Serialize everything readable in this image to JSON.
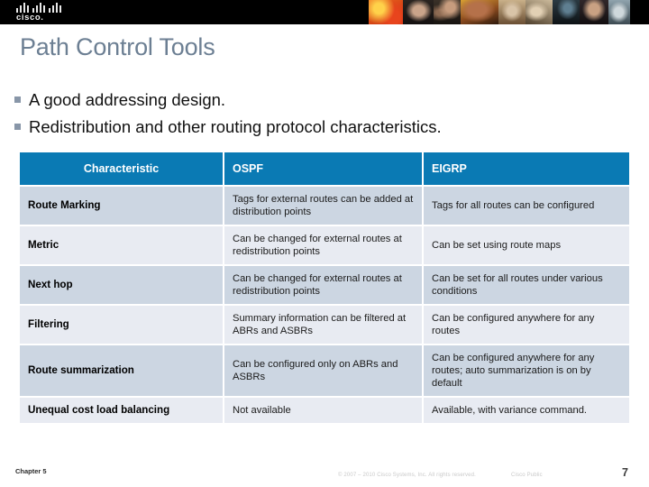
{
  "branding": {
    "logo_name": "cisco-logo",
    "wordmark": "cisco.",
    "banner_color": "#000000",
    "photostrip_name": "header-photo-strip"
  },
  "slide": {
    "title": "Path Control Tools",
    "title_color": "#6c7f93"
  },
  "bullets": [
    {
      "text": "A good addressing design."
    },
    {
      "text": "Redistribution and other routing protocol characteristics."
    }
  ],
  "table": {
    "header_color": "#0a7ab4",
    "row_dark_color": "#ccd6e2",
    "row_light_color": "#e8ebf2",
    "columns": [
      "Characteristic",
      "OSPF",
      "EIGRP"
    ],
    "rows": [
      {
        "characteristic": "Route Marking",
        "ospf": "Tags for external routes can be added at distribution points",
        "eigrp": "Tags for all routes can be configured"
      },
      {
        "characteristic": "Metric",
        "ospf": "Can be changed for external routes at redistribution points",
        "eigrp": "Can be set using route maps"
      },
      {
        "characteristic": "Next hop",
        "ospf": "Can be changed for external routes at redistribution points",
        "eigrp": "Can be set for all routes under various conditions"
      },
      {
        "characteristic": "Filtering",
        "ospf": "Summary information can be filtered at ABRs and ASBRs",
        "eigrp": "Can be configured anywhere for any routes"
      },
      {
        "characteristic": "Route summarization",
        "ospf": "Can be configured only on ABRs and ASBRs",
        "eigrp": "Can be configured anywhere for any routes; auto summarization is on by default"
      },
      {
        "characteristic": "Unequal cost load balancing",
        "ospf": "Not available",
        "eigrp": "Available, with variance command."
      }
    ]
  },
  "footer": {
    "chapter": "Chapter 5",
    "copyright": "© 2007 – 2010 Cisco Systems, Inc. All rights reserved.",
    "classification": "Cisco Public",
    "page_number": "7"
  }
}
